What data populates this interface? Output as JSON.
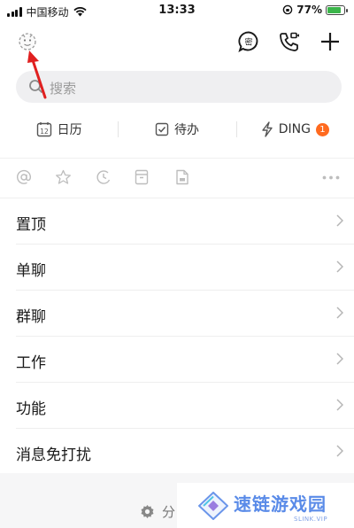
{
  "status_bar": {
    "carrier": "中国移动",
    "time": "13:33",
    "battery_percent": "77%",
    "battery_level": 0.77
  },
  "header": {
    "avatar_icon": "avatar-icon",
    "actions": [
      "secret-chat-icon",
      "video-call-icon",
      "add-icon"
    ]
  },
  "search": {
    "placeholder": "搜索"
  },
  "quick_actions": [
    {
      "icon": "calendar-icon",
      "label": "日历",
      "icon_text": "12"
    },
    {
      "icon": "todo-icon",
      "label": "待办"
    },
    {
      "icon": "ding-icon",
      "label": "DING",
      "badge": "1"
    }
  ],
  "filter_icons": [
    "mention-icon",
    "star-icon",
    "clock-icon",
    "archive-icon",
    "document-icon",
    "more-icon"
  ],
  "menu_items": [
    {
      "label": "置顶"
    },
    {
      "label": "单聊"
    },
    {
      "label": "群聊"
    },
    {
      "label": "工作"
    },
    {
      "label": "功能"
    },
    {
      "label": "消息免打扰"
    }
  ],
  "footer": {
    "settings_label": "分"
  },
  "watermark": {
    "title": "速链游戏园",
    "sub": "SLINK.VIP"
  },
  "colors": {
    "accent_badge": "#ff6a1f",
    "annotation_arrow": "#e02020",
    "watermark_blue": "#5a8be8"
  }
}
